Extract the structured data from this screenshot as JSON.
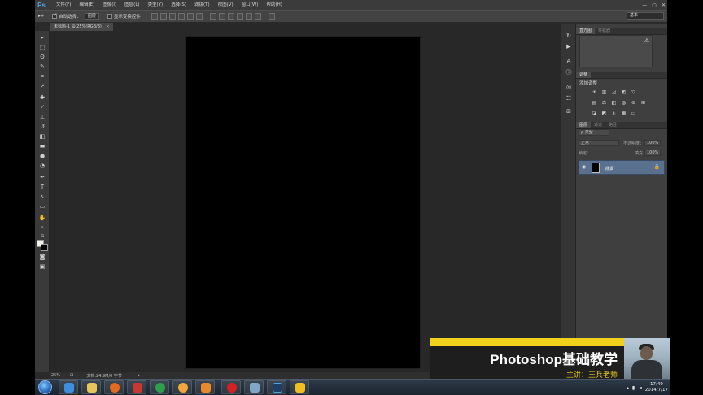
{
  "app": {
    "logo": "Ps",
    "menus": [
      "文件(F)",
      "编辑(E)",
      "图像(I)",
      "图层(L)",
      "类型(Y)",
      "选择(S)",
      "滤镜(T)",
      "视图(V)",
      "窗口(W)",
      "帮助(H)"
    ],
    "window_controls": [
      "—",
      "▢",
      "✕"
    ]
  },
  "options_bar": {
    "tool_glyph": "▸+",
    "auto_select_label": "自动选择：",
    "auto_select_checked": true,
    "auto_select_target": "图层",
    "show_transform_label": "显示变换控件",
    "show_transform_checked": false,
    "workspace": "基本"
  },
  "document": {
    "tab_label": "未标题-1 @ 25%(RGB/8)",
    "close": "×",
    "zoom": "25%",
    "doc_info": "文档:24.9M/0 字节"
  },
  "panels": {
    "histogram_tabs": [
      "直方图",
      "导航器"
    ],
    "histogram_warning": "⚠",
    "adjustments_tab": "调整",
    "adjustments_title": "添加调整",
    "layers_tabs": [
      "图层",
      "通道",
      "路径"
    ],
    "kind_filter": "ρ 类型",
    "blend_mode": "正常",
    "opacity_label": "不透明度：",
    "opacity_value": "100%",
    "lock_label": "锁定：",
    "fill_label": "填充：",
    "fill_value": "100%",
    "layer": {
      "name": "背景",
      "visible_icon": "eye-icon",
      "locked_icon": "lock-icon"
    }
  },
  "banner": {
    "title": "Photoshop基础教学",
    "presenter": "主讲：王兵老师",
    "accent_color": "#f0d21c"
  },
  "taskbar": {
    "time": "17:49",
    "date": "2014/7/17",
    "apps": [
      "ie",
      "explorer",
      "firefox",
      "browser",
      "media",
      "sohu",
      "recorder",
      "tool",
      "photoshop",
      "bird"
    ]
  }
}
